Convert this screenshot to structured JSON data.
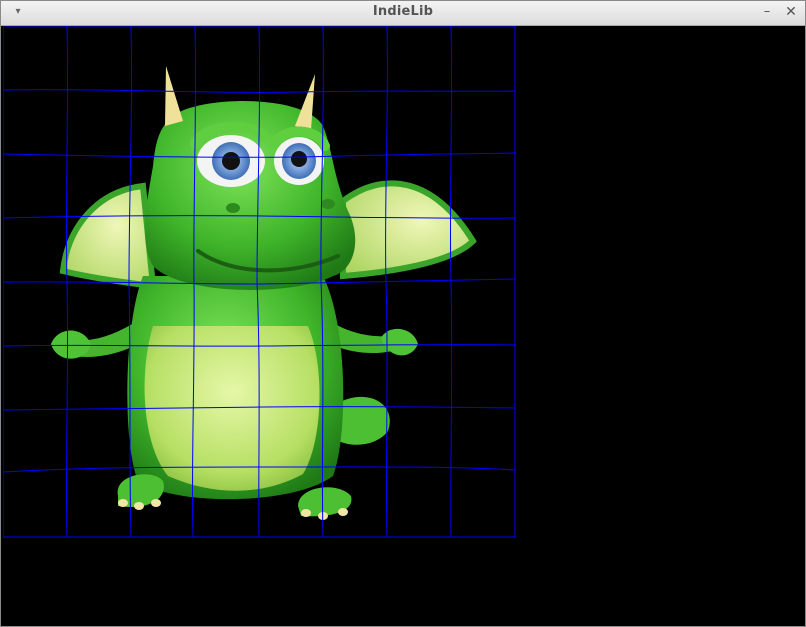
{
  "window": {
    "title": "IndieLib",
    "menu_icon": "chevron-down-icon",
    "minimize_icon": "minimize-icon",
    "close_icon": "close-icon",
    "minimize_glyph": "–",
    "close_glyph": "✕",
    "menu_glyph": "▾"
  },
  "scene": {
    "sprite": "green-dragon",
    "grid_color": "#0000ff",
    "background": "#000000",
    "grid_rows": 8,
    "grid_cols": 8
  }
}
